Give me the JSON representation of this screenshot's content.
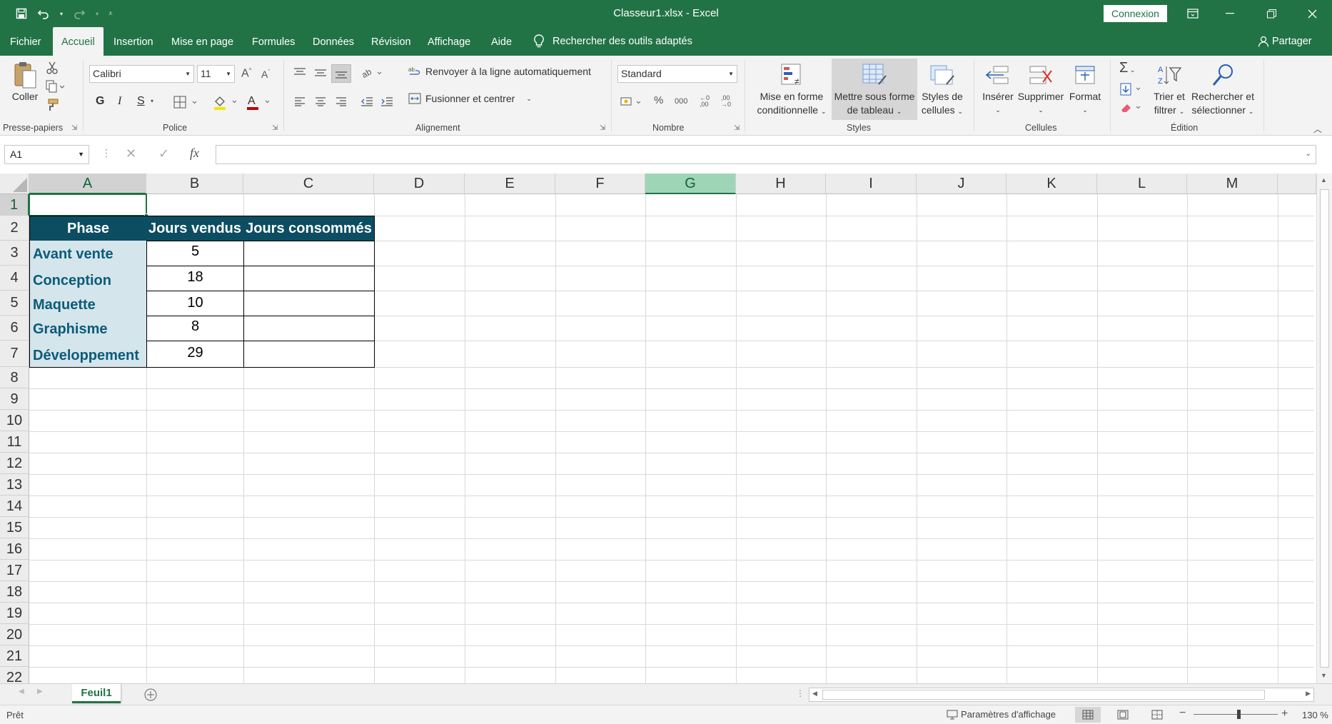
{
  "window": {
    "title": "Classeur1.xlsx  -  Excel",
    "signin_label": "Connexion",
    "accent_color": "#217346"
  },
  "tabs": [
    "Fichier",
    "Accueil",
    "Insertion",
    "Mise en page",
    "Formules",
    "Données",
    "Révision",
    "Affichage",
    "Aide"
  ],
  "active_tab": "Accueil",
  "tell_me": "Rechercher des outils adaptés",
  "share_label": "Partager",
  "ribbon": {
    "clipboard": {
      "paste_label": "Coller",
      "group_label": "Presse-papiers"
    },
    "font": {
      "name": "Calibri",
      "size": "11",
      "bold": "G",
      "italic": "I",
      "underline": "S",
      "group_label": "Police"
    },
    "alignment": {
      "wrap_label": "Renvoyer à la ligne automatiquement",
      "merge_label": "Fusionner et centrer",
      "group_label": "Alignement"
    },
    "number": {
      "format": "Standard",
      "percent": "%",
      "thousands": "000",
      "group_label": "Nombre"
    },
    "styles": {
      "conditional_l1": "Mise en forme",
      "conditional_l2": "conditionnelle",
      "table_l1": "Mettre sous forme",
      "table_l2": "de tableau",
      "cellstyles_l1": "Styles de",
      "cellstyles_l2": "cellules",
      "group_label": "Styles"
    },
    "cells": {
      "insert_label": "Insérer",
      "delete_label": "Supprimer",
      "format_label": "Format",
      "group_label": "Cellules"
    },
    "editing": {
      "sort_l1": "Trier et",
      "sort_l2": "filtrer",
      "find_l1": "Rechercher et",
      "find_l2": "sélectionner",
      "group_label": "Édition"
    }
  },
  "formula_bar": {
    "name_box": "A1",
    "fx": "fx",
    "formula": ""
  },
  "columns": [
    "A",
    "B",
    "C",
    "D",
    "E",
    "F",
    "G",
    "H",
    "I",
    "J",
    "K",
    "L",
    "M"
  ],
  "rows": [
    "1",
    "2",
    "3",
    "4",
    "5",
    "6",
    "7",
    "8",
    "9",
    "10",
    "11",
    "12",
    "13",
    "14",
    "15",
    "16",
    "17",
    "18",
    "19",
    "20",
    "21",
    "22"
  ],
  "table": {
    "headers": [
      "Phase",
      "Jours vendus",
      "Jours consommés"
    ],
    "rows": [
      {
        "phase": "Avant vente",
        "sold": "5",
        "consumed": ""
      },
      {
        "phase": "Conception",
        "sold": "18",
        "consumed": ""
      },
      {
        "phase": "Maquette",
        "sold": "10",
        "consumed": ""
      },
      {
        "phase": "Graphisme",
        "sold": "8",
        "consumed": ""
      },
      {
        "phase": "Développement",
        "sold": "29",
        "consumed": ""
      }
    ],
    "header_color": "#0c4d62",
    "phase_color": "#d5e5ec"
  },
  "sheets": [
    "Feuil1"
  ],
  "status": {
    "ready": "Prêt",
    "display_settings": "Paramètres d'affichage",
    "zoom": "130 %"
  }
}
